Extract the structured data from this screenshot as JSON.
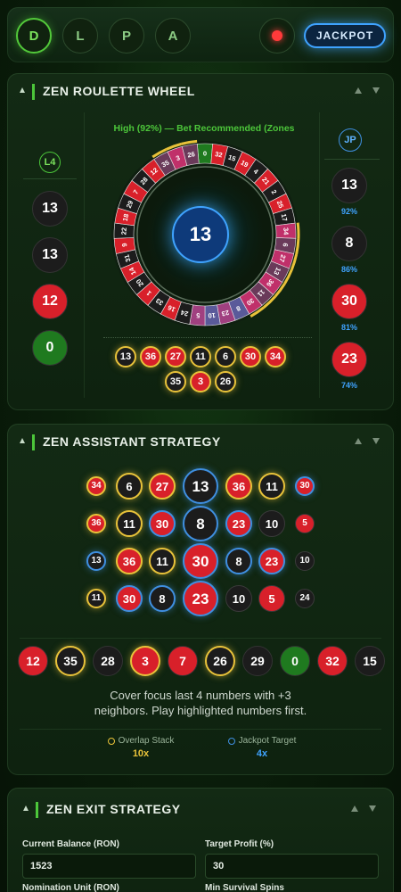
{
  "nav": {
    "buttons": [
      "D",
      "L",
      "P",
      "A"
    ],
    "active_index": 0,
    "jackpot_label": "JACKPOT"
  },
  "roulette": {
    "title": "ZEN ROULETTE WHEEL",
    "left_label": "L4",
    "right_label": "JP",
    "left_numbers": [
      {
        "n": "13",
        "color": "black"
      },
      {
        "n": "13",
        "color": "black"
      },
      {
        "n": "12",
        "color": "red"
      },
      {
        "n": "0",
        "color": "green"
      }
    ],
    "jackpot_numbers": [
      {
        "n": "13",
        "color": "black",
        "pct": "92%"
      },
      {
        "n": "8",
        "color": "black",
        "pct": "86%"
      },
      {
        "n": "30",
        "color": "red",
        "pct": "81%"
      },
      {
        "n": "23",
        "color": "red",
        "pct": "74%"
      }
    ],
    "recommendation": "High (92%) — Bet Recommended (Zones",
    "center_number": "13",
    "wheel_numbers": [
      "0",
      "32",
      "15",
      "19",
      "4",
      "21",
      "2",
      "25",
      "17",
      "34",
      "6",
      "27",
      "13",
      "36",
      "11",
      "30",
      "8",
      "23",
      "10",
      "5",
      "24",
      "16",
      "33",
      "1",
      "20",
      "14",
      "31",
      "9",
      "22",
      "18",
      "29",
      "7",
      "28",
      "12",
      "35",
      "3",
      "26"
    ],
    "history_row1": [
      {
        "n": "13",
        "color": "black",
        "ring": "gold"
      },
      {
        "n": "36",
        "color": "red",
        "ring": "gold"
      },
      {
        "n": "27",
        "color": "red",
        "ring": "gold"
      },
      {
        "n": "11",
        "color": "black",
        "ring": "gold"
      },
      {
        "n": "6",
        "color": "black",
        "ring": "gold"
      },
      {
        "n": "30",
        "color": "red",
        "ring": "gold"
      },
      {
        "n": "34",
        "color": "red",
        "ring": "gold"
      }
    ],
    "history_row2": [
      {
        "n": "35",
        "color": "black",
        "ring": "gold"
      },
      {
        "n": "3",
        "color": "red",
        "ring": "gold"
      },
      {
        "n": "26",
        "color": "black",
        "ring": "gold"
      }
    ]
  },
  "strategy": {
    "title": "ZEN ASSISTANT STRATEGY",
    "grid_rows": [
      [
        {
          "n": "34",
          "color": "red",
          "ring": "gold",
          "size": "s"
        },
        {
          "n": "6",
          "color": "black",
          "ring": "gold",
          "size": "m"
        },
        {
          "n": "27",
          "color": "red",
          "ring": "gold",
          "size": "m"
        },
        {
          "n": "13",
          "color": "black",
          "ring": "blue",
          "size": "l"
        },
        {
          "n": "36",
          "color": "red",
          "ring": "gold",
          "size": "m"
        },
        {
          "n": "11",
          "color": "black",
          "ring": "gold",
          "size": "m"
        },
        {
          "n": "30",
          "color": "red",
          "ring": "blue",
          "size": "s"
        }
      ],
      [
        {
          "n": "36",
          "color": "red",
          "ring": "gold",
          "size": "s"
        },
        {
          "n": "11",
          "color": "black",
          "ring": "gold",
          "size": "m"
        },
        {
          "n": "30",
          "color": "red",
          "ring": "blue",
          "size": "m"
        },
        {
          "n": "8",
          "color": "black",
          "ring": "blue",
          "size": "l"
        },
        {
          "n": "23",
          "color": "red",
          "ring": "blue",
          "size": "m"
        },
        {
          "n": "10",
          "color": "black",
          "ring": "gray",
          "size": "m"
        },
        {
          "n": "5",
          "color": "red",
          "ring": "gray",
          "size": "s"
        }
      ],
      [
        {
          "n": "13",
          "color": "black",
          "ring": "blue",
          "size": "s"
        },
        {
          "n": "36",
          "color": "red",
          "ring": "gold",
          "size": "m"
        },
        {
          "n": "11",
          "color": "black",
          "ring": "gold",
          "size": "m"
        },
        {
          "n": "30",
          "color": "red",
          "ring": "blue",
          "size": "l"
        },
        {
          "n": "8",
          "color": "black",
          "ring": "blue",
          "size": "m"
        },
        {
          "n": "23",
          "color": "red",
          "ring": "blue",
          "size": "m"
        },
        {
          "n": "10",
          "color": "black",
          "ring": "gray",
          "size": "s"
        }
      ],
      [
        {
          "n": "11",
          "color": "black",
          "ring": "gold",
          "size": "s"
        },
        {
          "n": "30",
          "color": "red",
          "ring": "blue",
          "size": "m"
        },
        {
          "n": "8",
          "color": "black",
          "ring": "blue",
          "size": "m"
        },
        {
          "n": "23",
          "color": "red",
          "ring": "blue",
          "size": "l"
        },
        {
          "n": "10",
          "color": "black",
          "ring": "gray",
          "size": "m"
        },
        {
          "n": "5",
          "color": "red",
          "ring": "gray",
          "size": "m"
        },
        {
          "n": "24",
          "color": "black",
          "ring": "gray",
          "size": "s"
        }
      ]
    ],
    "recent": [
      {
        "n": "12",
        "color": "red",
        "ring": "none"
      },
      {
        "n": "35",
        "color": "black",
        "ring": "gold"
      },
      {
        "n": "28",
        "color": "black",
        "ring": "none"
      },
      {
        "n": "3",
        "color": "red",
        "ring": "gold"
      },
      {
        "n": "7",
        "color": "red",
        "ring": "none"
      },
      {
        "n": "26",
        "color": "black",
        "ring": "gold"
      },
      {
        "n": "29",
        "color": "black",
        "ring": "none"
      },
      {
        "n": "0",
        "color": "green",
        "ring": "none"
      },
      {
        "n": "32",
        "color": "red",
        "ring": "none"
      },
      {
        "n": "15",
        "color": "black",
        "ring": "none"
      }
    ],
    "advice_line1": "Cover focus last 4 numbers with +3",
    "advice_line2": "neighbors. Play highlighted numbers first.",
    "overlap_label": "Overlap Stack",
    "overlap_value": "10x",
    "jackpot_target_label": "Jackpot Target",
    "jackpot_target_value": "4x"
  },
  "exit": {
    "title": "ZEN EXIT STRATEGY",
    "balance_label": "Current Balance (RON)",
    "balance_value": "1523",
    "target_label": "Target Profit (%)",
    "target_value": "30",
    "unit_label": "Nomination Unit (RON)",
    "spins_label": "Min Survival Spins"
  },
  "colors": {
    "red": "#d8202a",
    "black": "#1c1c1c",
    "green": "#1f7a1f",
    "gold": "#e8c23a",
    "blue": "#3f8fe0",
    "accent_green": "#4cc63a"
  }
}
